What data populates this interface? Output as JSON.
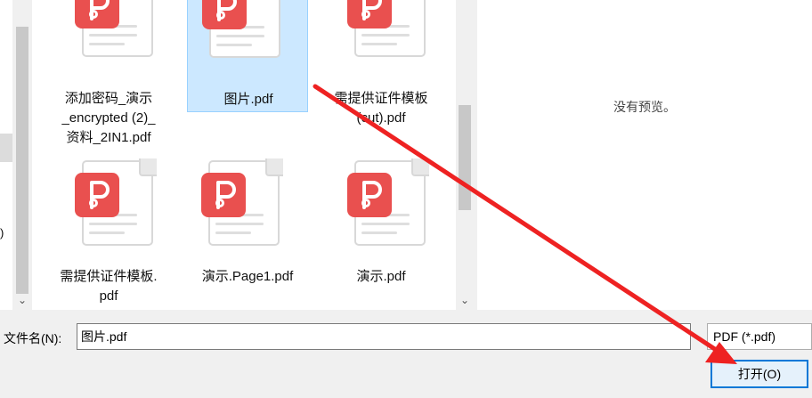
{
  "left_pane": {
    "fragment": ")"
  },
  "files": [
    {
      "name": "添加密码_演示\n_encrypted (2)_\n资料_2IN1.pdf",
      "selected": false
    },
    {
      "name": "图片.pdf",
      "selected": true
    },
    {
      "name": "需提供证件模板\n(cut).pdf",
      "selected": false
    },
    {
      "name": "需提供证件模板.\npdf",
      "selected": false
    },
    {
      "name": "演示.Page1.pdf",
      "selected": false
    },
    {
      "name": "演示.pdf",
      "selected": false
    }
  ],
  "preview": {
    "message": "没有预览。"
  },
  "footer": {
    "filename_label": "文件名(N):",
    "filename_value": "图片.pdf",
    "filter_value": "PDF (*.pdf)",
    "open_label": "打开(O)"
  },
  "icons": {
    "file": "pdf-file-icon",
    "scroll_down": "chevron-down-icon"
  },
  "colors": {
    "pdf_badge": "#e9504f",
    "selection": "#cce8ff",
    "annotation_arrow": "#ee2222"
  }
}
